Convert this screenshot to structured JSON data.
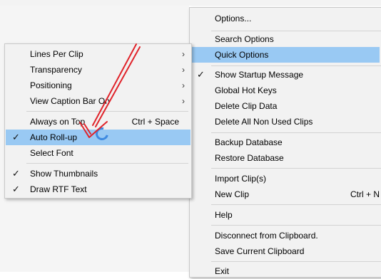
{
  "main_menu": {
    "items": [
      {
        "label": "Options..."
      },
      {
        "label": "Search Options"
      },
      {
        "label": "Quick Options"
      },
      {
        "label": "Show Startup Message"
      },
      {
        "label": "Global Hot Keys"
      },
      {
        "label": "Delete Clip Data"
      },
      {
        "label": "Delete All Non Used Clips"
      },
      {
        "label": "Backup Database"
      },
      {
        "label": "Restore Database"
      },
      {
        "label": "Import Clip(s)"
      },
      {
        "label": "New Clip",
        "shortcut": "Ctrl + N"
      },
      {
        "label": "Help"
      },
      {
        "label": "Disconnect from Clipboard."
      },
      {
        "label": "Save Current Clipboard"
      },
      {
        "label": "Exit"
      }
    ]
  },
  "sub_menu": {
    "items": [
      {
        "label": "Lines Per Clip"
      },
      {
        "label": "Transparency"
      },
      {
        "label": "Positioning"
      },
      {
        "label": "View Caption Bar On"
      },
      {
        "label": "Always on Top",
        "shortcut": "Ctrl + Space"
      },
      {
        "label": "Auto Roll-up"
      },
      {
        "label": "Select Font"
      },
      {
        "label": "Show Thumbnails"
      },
      {
        "label": "Draw RTF Text"
      }
    ]
  },
  "glyphs": {
    "chevron": "›",
    "check": "✓"
  },
  "colors": {
    "highlight": "#99c9f3",
    "annotation_arrow": "#e0242b",
    "cursor": "#3f8ae0"
  }
}
